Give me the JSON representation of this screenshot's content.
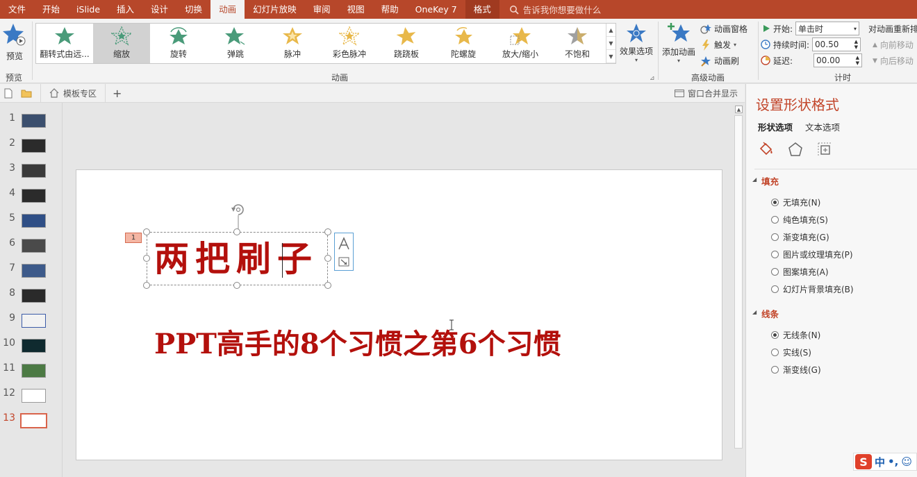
{
  "menu": {
    "tabs": [
      "文件",
      "开始",
      "iSlide",
      "插入",
      "设计",
      "切换",
      "动画",
      "幻灯片放映",
      "审阅",
      "视图",
      "帮助",
      "OneKey 7",
      "格式"
    ],
    "active_index": 6,
    "context_index": 12,
    "tell_me": "告诉我你想要做什么"
  },
  "ribbon": {
    "preview": {
      "button": "预览",
      "group": "预览"
    },
    "animation_group": "动画",
    "gallery": [
      {
        "label": "翻转式由远...",
        "color": "#4a9b7a"
      },
      {
        "label": "缩放",
        "color": "#4a9b7a"
      },
      {
        "label": "旋转",
        "color": "#4a9b7a"
      },
      {
        "label": "弹跳",
        "color": "#4a9b7a"
      },
      {
        "label": "脉冲",
        "color": "#e8b84a"
      },
      {
        "label": "彩色脉冲",
        "color": "#e8b84a"
      },
      {
        "label": "跷跷板",
        "color": "#e8b84a"
      },
      {
        "label": "陀螺旋",
        "color": "#e8b84a"
      },
      {
        "label": "放大/缩小",
        "color": "#e8b84a"
      },
      {
        "label": "不饱和",
        "color": "#a0a0a0"
      }
    ],
    "selected_effect_index": 1,
    "effect_options": "效果选项",
    "advanced": {
      "add_animation": "添加动画",
      "pane": "动画窗格",
      "trigger": "触发",
      "painter": "动画刷",
      "group": "高级动画"
    },
    "timing": {
      "start_label": "开始:",
      "start_value": "单击时",
      "duration_label": "持续时间:",
      "duration_value": "00.50",
      "delay_label": "延迟:",
      "delay_value": "00.00",
      "group": "计时",
      "reorder_title": "对动画重新排",
      "move_earlier": "向前移动",
      "move_later": "向后移动"
    }
  },
  "quickbar": {
    "tab_label": "模板专区",
    "add": "+",
    "merge_windows": "窗口合并显示"
  },
  "slides": {
    "numbers": [
      "1",
      "2",
      "3",
      "4",
      "5",
      "6",
      "7",
      "8",
      "9",
      "10",
      "11",
      "12",
      "13"
    ],
    "active": 13
  },
  "slide": {
    "anim_badge": "1",
    "title": "两把刷子",
    "subtitle": "PPT高手的8个习惯之第6个习惯",
    "text_color": "#b3100c"
  },
  "panel": {
    "title": "设置形状格式",
    "tabs": [
      "形状选项",
      "文本选项"
    ],
    "fill_section": "填充",
    "fill_options": [
      "无填充(N)",
      "纯色填充(S)",
      "渐变填充(G)",
      "图片或纹理填充(P)",
      "图案填充(A)",
      "幻灯片背景填充(B)"
    ],
    "line_section": "线条",
    "line_options": [
      "无线条(N)",
      "实线(S)",
      "渐变线(G)"
    ]
  },
  "ime": {
    "logo": "S",
    "mode": "中",
    "punct": "•,",
    "emoji": "☺"
  }
}
